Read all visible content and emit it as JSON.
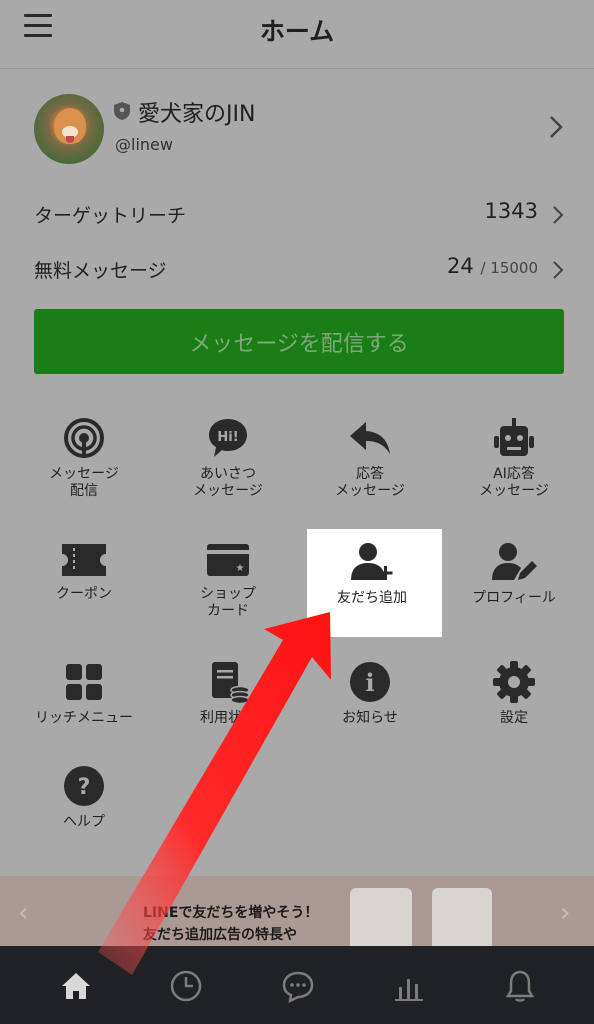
{
  "header": {
    "title": "ホーム"
  },
  "profile": {
    "name": "愛犬家のJIN",
    "id": "@linew"
  },
  "stats": [
    {
      "label": "ターゲットリーチ",
      "value": "1343",
      "limit": ""
    },
    {
      "label": "無料メッセージ",
      "value": "24",
      "limit": "/ 15000"
    }
  ],
  "send_button": {
    "label": "メッセージを配信する"
  },
  "menu": [
    {
      "label": "メッセージ\n配信",
      "icon": "broadcast-icon"
    },
    {
      "label": "あいさつ\nメッセージ",
      "icon": "hi-bubble-icon",
      "icon_text": "Hi!"
    },
    {
      "label": "応答\nメッセージ",
      "icon": "reply-arrow-icon"
    },
    {
      "label": "AI応答\nメッセージ",
      "icon": "robot-icon"
    },
    {
      "label": "クーポン",
      "icon": "coupon-icon"
    },
    {
      "label": "ショップ\nカード",
      "icon": "shop-card-icon"
    },
    {
      "label": "友だち追加",
      "icon": "add-friend-icon"
    },
    {
      "label": "プロフィール",
      "icon": "profile-edit-icon"
    },
    {
      "label": "リッチメニュー",
      "icon": "rich-menu-icon"
    },
    {
      "label": "利用状況",
      "icon": "usage-stats-icon"
    },
    {
      "label": "お知らせ",
      "icon": "info-icon",
      "icon_text": "i"
    },
    {
      "label": "設定",
      "icon": "gear-icon"
    },
    {
      "label": "ヘルプ",
      "icon": "help-icon",
      "icon_text": "?"
    }
  ],
  "banner": {
    "line1": "LINEで友だちを増やそう！",
    "line2": "友だち追加広告の特長や"
  },
  "bottom_nav": [
    "home-icon",
    "clock-icon",
    "chat-icon",
    "chart-icon",
    "bell-icon"
  ],
  "colors": {
    "accent_green": "#1b7d17",
    "overlay_gray": "#a9a9a9",
    "arrow_red": "#ff1f1f",
    "nav_dark": "#1f2124"
  }
}
